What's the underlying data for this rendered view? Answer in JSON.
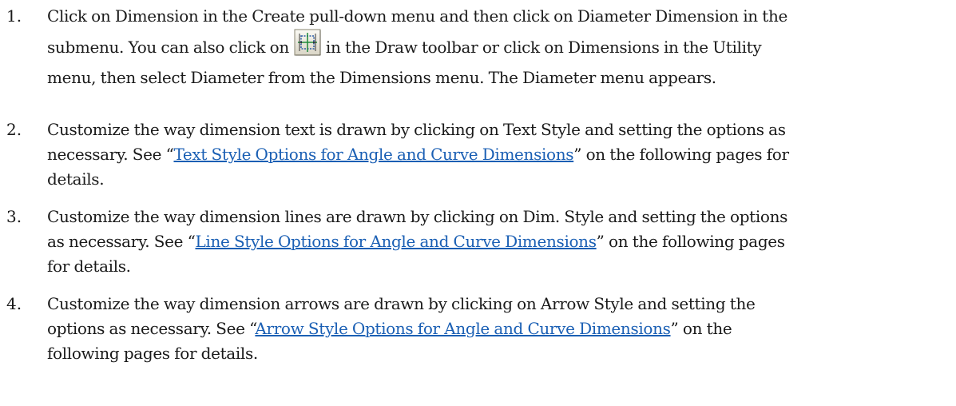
{
  "steps": [
    {
      "number": "1.",
      "lines": [
        {
          "text": "Click on Dimension in the Create pull-down menu and then click on Diameter Dimension in the"
        },
        {
          "before": "submenu. You can also click on",
          "after": "in the Draw toolbar or click on Dimensions in the Utility",
          "icon": "diameter-dimension-icon"
        },
        {
          "text": "menu, then select Diameter from the Dimensions menu. The Diameter menu appears."
        }
      ]
    },
    {
      "number": "2.",
      "line1_text": "Customize the way dimension text is drawn by clicking on Text Style and setting the options as",
      "line2_pre": "necessary. See “",
      "line2_link": "Text Style Options for Angle and Curve Dimensions",
      "line2_post": "” on the following pages for",
      "line3_text": "details."
    },
    {
      "number": "3.",
      "line1_text": "Customize the way dimension lines are drawn by clicking on Dim. Style and setting the options",
      "line2_pre": "as necessary. See “",
      "line2_link": "Line Style Options for Angle and Curve Dimensions",
      "line2_post": "” on the following pages",
      "line3_text": "for details."
    },
    {
      "number": "4.",
      "line1_text": "Customize the way dimension arrows are drawn by clicking on Arrow Style and setting the",
      "line2_pre": "options as necessary. See “",
      "line2_link": "Arrow Style Options for Angle and Curve Dimensions",
      "line2_post": "” on the",
      "line3_text": "following pages for details."
    }
  ]
}
